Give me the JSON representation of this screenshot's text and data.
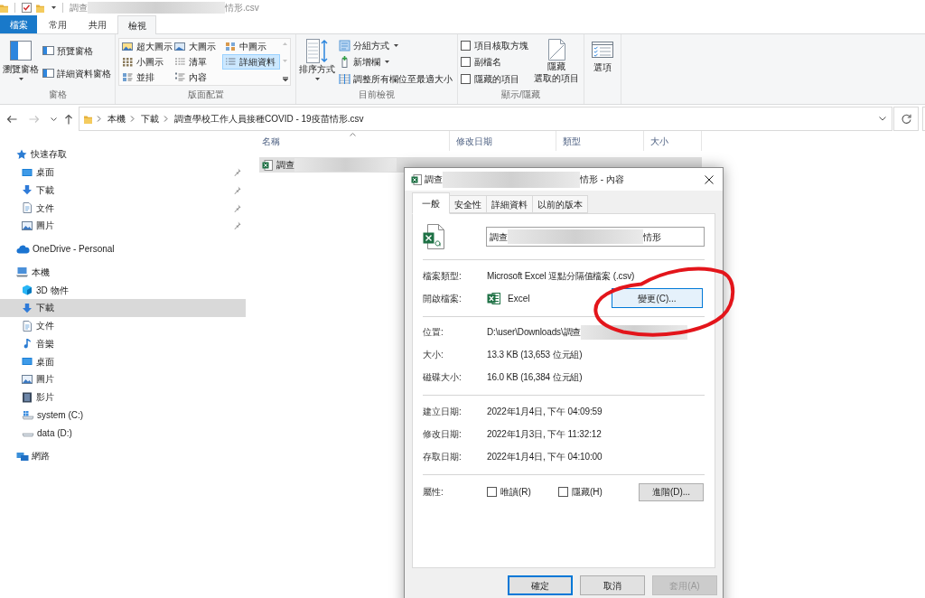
{
  "window": {
    "title": {
      "before": "調查",
      "redacted": true,
      "after": "情形.csv"
    }
  },
  "ribbon": {
    "tabs": [
      {
        "label": "檔案",
        "kind": "file",
        "selected": false
      },
      {
        "label": "常用",
        "kind": "tab",
        "selected": false
      },
      {
        "label": "共用",
        "kind": "tab",
        "selected": false
      },
      {
        "label": "檢視",
        "kind": "tab",
        "selected": true
      }
    ],
    "panes": {
      "label": "窗格",
      "navigation_pane": "瀏覽窗格",
      "items": [
        {
          "label": "預覽窗格"
        },
        {
          "label": "詳細資料窗格"
        }
      ]
    },
    "layout": {
      "label": "版面配置",
      "options": [
        {
          "label": "超大圖示",
          "kind": "extra_large",
          "selected": false
        },
        {
          "label": "大圖示",
          "kind": "large",
          "selected": false
        },
        {
          "label": "中圖示",
          "kind": "medium",
          "selected": false
        },
        {
          "label": "小圖示",
          "kind": "small",
          "selected": false
        },
        {
          "label": "清單",
          "kind": "list",
          "selected": false
        },
        {
          "label": "詳細資料",
          "kind": "details",
          "selected": true
        },
        {
          "label": "並排",
          "kind": "tiles",
          "selected": false
        },
        {
          "label": "內容",
          "kind": "content",
          "selected": false
        }
      ]
    },
    "current_view": {
      "label": "目前檢視",
      "sort": "排序方式",
      "items": [
        {
          "label": "分組方式",
          "kind": "group_by",
          "dropdown": true
        },
        {
          "label": "新增欄",
          "kind": "add_column",
          "dropdown": true
        },
        {
          "label": "調整所有欄位至最適大小",
          "kind": "fit_columns",
          "dropdown": false
        }
      ]
    },
    "show_hide": {
      "label": "顯示/隱藏",
      "checkboxes": [
        {
          "label": "項目核取方塊",
          "checked": false
        },
        {
          "label": "副檔名",
          "checked": false
        },
        {
          "label": "隱藏的項目",
          "checked": false
        }
      ],
      "hide_selected": [
        "隱藏",
        "選取的項目"
      ]
    },
    "options": {
      "label": "選項"
    }
  },
  "address_bar": {
    "nav_buttons": [
      {
        "kind": "back",
        "disabled": false
      },
      {
        "kind": "forward",
        "disabled": true
      },
      {
        "kind": "recent",
        "disabled": false
      },
      {
        "kind": "up",
        "disabled": false
      }
    ],
    "path": [
      "本機",
      "下載",
      "調查學校工作人員接種COVID - 19疫苗情形.csv"
    ]
  },
  "navigation_pane": {
    "items": [
      {
        "label": "快速存取",
        "kind": "quick_access",
        "selected": false,
        "children": [
          {
            "label": "桌面",
            "kind": "desktop",
            "pinned": true,
            "selected": false
          },
          {
            "label": "下載",
            "kind": "downloads",
            "pinned": true,
            "selected": false
          },
          {
            "label": "文件",
            "kind": "documents",
            "pinned": true,
            "selected": false
          },
          {
            "label": "圖片",
            "kind": "pictures",
            "pinned": true,
            "selected": false
          }
        ]
      },
      {
        "label": "OneDrive - Personal",
        "kind": "onedrive",
        "selected": false
      },
      {
        "label": "本機",
        "kind": "pc",
        "selected": false,
        "children": [
          {
            "label": "3D 物件",
            "kind": "objects_3d",
            "selected": false
          },
          {
            "label": "下載",
            "kind": "downloads",
            "selected": true
          },
          {
            "label": "文件",
            "kind": "documents",
            "selected": false
          },
          {
            "label": "音樂",
            "kind": "music",
            "selected": false
          },
          {
            "label": "桌面",
            "kind": "desktop",
            "selected": false
          },
          {
            "label": "圖片",
            "kind": "pictures",
            "selected": false
          },
          {
            "label": "影片",
            "kind": "videos",
            "selected": false
          },
          {
            "label": "system (C:)",
            "kind": "system_drive",
            "selected": false
          },
          {
            "label": "data (D:)",
            "kind": "drive",
            "selected": false
          }
        ]
      },
      {
        "label": "網路",
        "kind": "network",
        "selected": false
      }
    ]
  },
  "file_list": {
    "columns": [
      {
        "label": "名稱",
        "sorted": true
      },
      {
        "label": "修改日期",
        "sorted": false
      },
      {
        "label": "類型",
        "sorted": false
      },
      {
        "label": "大小",
        "sorted": false
      }
    ],
    "rows": [
      {
        "name": "調查",
        "redacted": true,
        "selected": true
      }
    ]
  },
  "properties_dialog": {
    "title": {
      "before": "調查",
      "redacted": true,
      "after": "情形 - 內容"
    },
    "tabs": [
      {
        "label": "一般",
        "selected": true
      },
      {
        "label": "安全性",
        "selected": false
      },
      {
        "label": "詳細資料",
        "selected": false
      },
      {
        "label": "以前的版本",
        "selected": false
      }
    ],
    "file_name": {
      "before": "調查",
      "redacted": true,
      "after": "情形"
    },
    "sections": [
      [
        {
          "label": "檔案類型:",
          "kind": "text",
          "value": "Microsoft Excel 逗點分隔值檔案 (.csv)"
        },
        {
          "label": "開啟檔案:",
          "kind": "app",
          "value": "Excel",
          "button": "變更(C)..."
        }
      ],
      [
        {
          "label": "位置:",
          "kind": "text",
          "value": "D:\\user\\Downloads\\調查",
          "redacted": true
        },
        {
          "label": "大小:",
          "kind": "text",
          "value": "13.3 KB (13,653 位元組)"
        },
        {
          "label": "磁碟大小:",
          "kind": "text",
          "value": "16.0 KB (16,384 位元組)"
        }
      ],
      [
        {
          "label": "建立日期:",
          "kind": "text",
          "value": "2022年1月4日, 下午 04:09:59"
        },
        {
          "label": "修改日期:",
          "kind": "text",
          "value": "2022年1月3日, 下午 11:32:12"
        },
        {
          "label": "存取日期:",
          "kind": "text",
          "value": "2022年1月4日, 下午 04:10:00"
        }
      ]
    ],
    "attributes": {
      "label": "屬性:",
      "checkboxes": [
        {
          "label": "唯讀(R)",
          "checked": false
        },
        {
          "label": "隱藏(H)",
          "checked": false
        }
      ],
      "button": "進階(D)..."
    },
    "buttons": [
      {
        "label": "確定",
        "kind": "default",
        "disabled": false
      },
      {
        "label": "取消",
        "kind": "normal",
        "disabled": false
      },
      {
        "label": "套用(A)",
        "kind": "normal",
        "disabled": true
      }
    ]
  },
  "annotations": [
    {
      "kind": "ellipse"
    }
  ]
}
